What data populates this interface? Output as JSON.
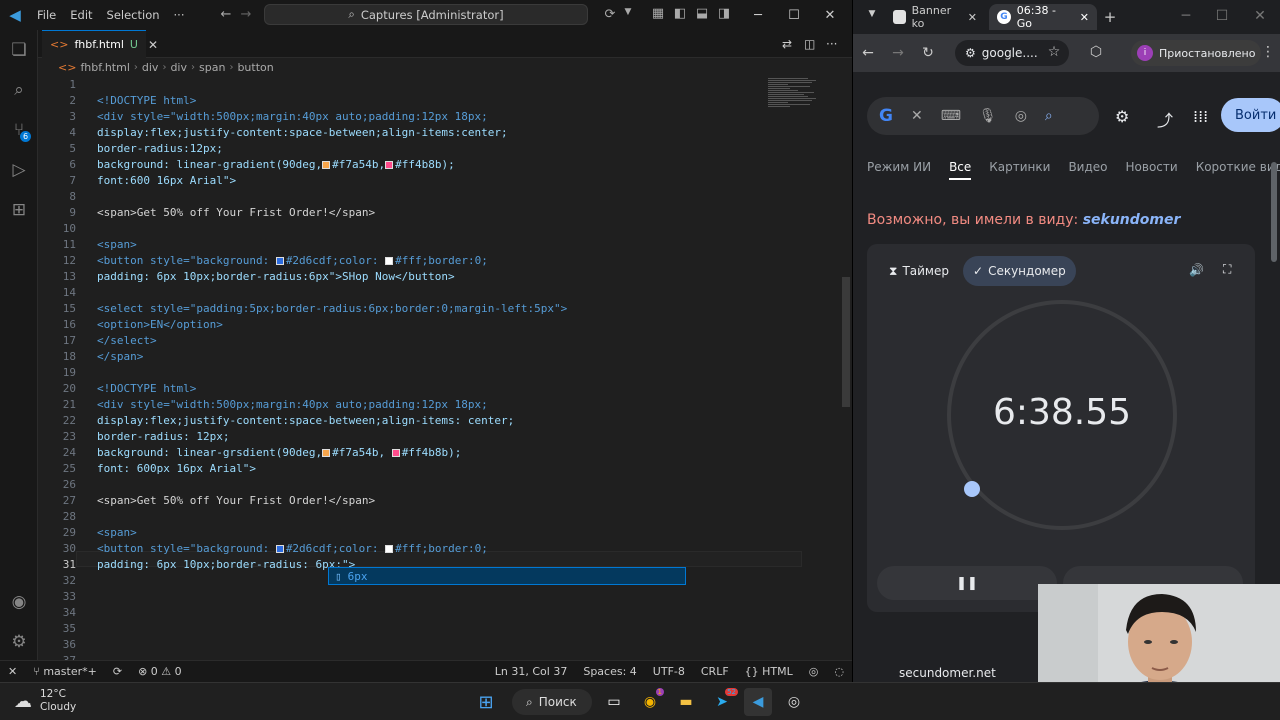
{
  "vscode": {
    "menus": [
      "File",
      "Edit",
      "Selection",
      "···"
    ],
    "command_center": "Captures [Administrator]",
    "tab": {
      "name": "fhbf.html",
      "modified_mark": "U"
    },
    "breadcrumb": [
      "fhbf.html",
      "div",
      "div",
      "span",
      "button"
    ],
    "line_numbers": [
      "1",
      "2",
      "3",
      "4",
      "5",
      "6",
      "7",
      "8",
      "9",
      "10",
      "11",
      "12",
      "13",
      "14",
      "15",
      "16",
      "17",
      "18",
      "19",
      "20",
      "21",
      "22",
      "23",
      "24",
      "25",
      "26",
      "27",
      "28",
      "29",
      "30",
      "31",
      "32",
      "33",
      "34",
      "35",
      "36",
      "37"
    ],
    "active_line": "31",
    "suggestion": "6px",
    "statusbar": {
      "branch": "master*+",
      "errors": "0",
      "warnings": "0",
      "position": "Ln 31, Col 37",
      "spaces": "Spaces: 4",
      "encoding": "UTF-8",
      "eol": "CRLF",
      "language": "HTML"
    },
    "explorer_badge": "6"
  },
  "code": {
    "l2": "<!DOCTYPE html>",
    "l3": "<div style=\"width:500px;margin:40px auto;padding:12px 18px;",
    "l4": "display:flex;justify-content:space-between;align-items:center;",
    "l5": "border-radius:12px;",
    "l6a": "background: linear-gradient(90deg,",
    "l6b": "#f7a54b,",
    "l6c": "#ff4b8b);",
    "l7": "font:600 16px Arial\">",
    "l9": "<span>Get 50% off Your Frist Order!</span>",
    "l11": "<span>",
    "l12a": "<button style=\"background: ",
    "l12b": "#2d6cdf;color: ",
    "l12c": "#fff;border:0;",
    "l13": "padding: 6px 10px;border-radius:6px\">SHop Now</button>",
    "l15": "<select style=\"padding:5px;border-radius:6px;border:0;margin-left:5px\">",
    "l16": "<option>EN</option>",
    "l17": "</select>",
    "l18": "</span>",
    "l20": "<!DOCTYPE html>",
    "l21": "<div style=\"width:500px;margin:40px auto;padding:12px 18px;",
    "l22": "display:flex;justify-content:space-between;align-items: center;",
    "l23": "border-radius: 12px;",
    "l24a": "background: linear-grsdient(90deg,",
    "l24b": "#f7a54b, ",
    "l24c": "#ff4b8b);",
    "l25": "font: 600px 16px Arial\">",
    "l27": "<span>Get 50% off Your Frist Order!</span>",
    "l29": "<span>",
    "l30a": "<button style=\"background: ",
    "l30b": "#2d6cdf;color: ",
    "l30c": "#fff;border:0;",
    "l31": "padding: 6px 10px;border-radius: 6px;\">"
  },
  "colors": {
    "orange": "#f7a54b",
    "pink": "#ff4b8b",
    "blue": "#2d6cdf",
    "white": "#ffffff"
  },
  "chrome": {
    "tabs": [
      "Banner ko",
      "06:38 - Go"
    ],
    "omnibox": "google....",
    "profile_status": "Приостановлено",
    "profile_initial": "i",
    "signin": "Войти",
    "search_tabs": [
      "Режим ИИ",
      "Все",
      "Картинки",
      "Видео",
      "Новости",
      "Короткие виде"
    ],
    "did_you_mean_prefix": "Возможно, вы имели в виду:",
    "did_you_mean_term": "sekundomer",
    "widget": {
      "timer_tab": "Таймер",
      "stopwatch_tab": "Секундомер",
      "time": "6:38.55"
    },
    "site": "secundomer.net"
  },
  "taskbar": {
    "temp": "12°C",
    "condition": "Cloudy",
    "search": "Поиск",
    "chrome_badge": "1",
    "telegram_badge": "52"
  }
}
